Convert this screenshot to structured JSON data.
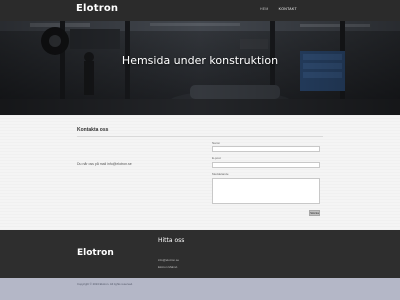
{
  "header": {
    "logo": "Elotron",
    "nav": [
      {
        "label": "Hem",
        "active": false
      },
      {
        "label": "Kontakt",
        "active": true
      }
    ]
  },
  "hero": {
    "title": "Hemsida under konstruktion"
  },
  "contact": {
    "title": "Kontakta oss",
    "text": "Du når oss på mail info@elotron.se",
    "fields": {
      "name_label": "Namn",
      "email_label": "E-post",
      "message_label": "Meddelande"
    },
    "submit_label": "Skicka"
  },
  "footer": {
    "logo": "Elotron",
    "heading": "Hitta oss",
    "lines": [
      "info@elotron.se",
      "Elotron Malmö"
    ]
  },
  "bottom": {
    "copyright": "Copyright © 2024 Elotron. All rights reserved."
  },
  "colors": {
    "topbar": "#2b2b2b",
    "footer": "#2e2e2e",
    "bottombar": "#b4b7c7",
    "content_bg": "#f4f4f4"
  }
}
